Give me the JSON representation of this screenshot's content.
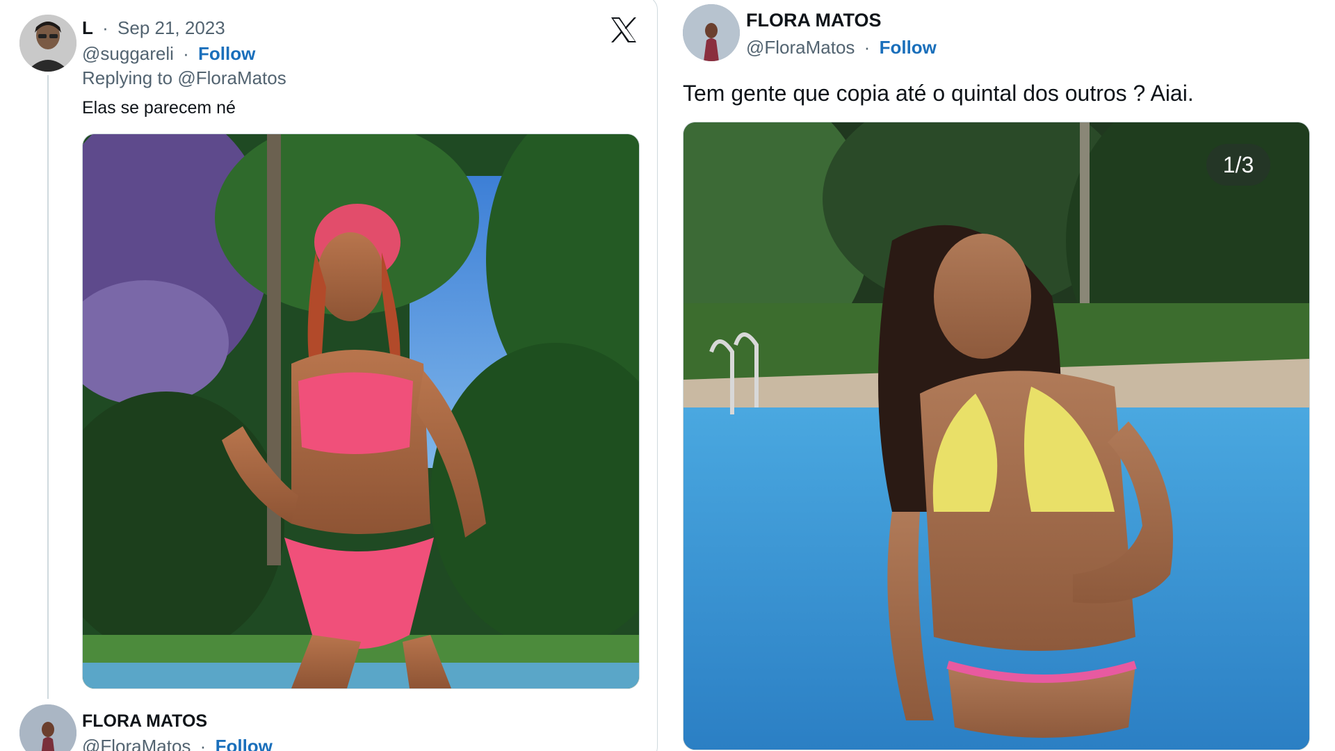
{
  "reply_tweet": {
    "author_name": "L",
    "date": "Sep 21, 2023",
    "handle": "@suggareli",
    "follow_label": "Follow",
    "replying_to_label": "Replying to",
    "replying_to_handle": "@FloraMatos",
    "text": "Elas se parecem né"
  },
  "thread_next": {
    "author_name": "FLORA MATOS",
    "handle": "@FloraMatos",
    "follow_label": "Follow"
  },
  "original_tweet": {
    "author_name": "FLORA MATOS",
    "handle": "@FloraMatos",
    "follow_label": "Follow",
    "text": "Tem gente que copia até o quintal dos outros ?  Aiai.",
    "media_counter": "1/3"
  },
  "icons": {
    "x_logo": "x-logo-icon"
  },
  "colors": {
    "follow_blue": "#1d9bf0",
    "muted_gray": "#536471",
    "border": "#cfd9de"
  }
}
